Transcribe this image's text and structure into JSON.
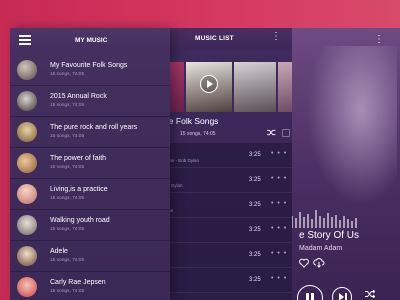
{
  "my_music": {
    "title": "MY MUSIC",
    "playlists": [
      {
        "name": "My Favourite Folk Songs",
        "meta": "15 songs, 74:05"
      },
      {
        "name": "2015 Annual Rock",
        "meta": "15 songs, 74:05"
      },
      {
        "name": "The pure rock and roll years",
        "meta": "15 songs, 74:05"
      },
      {
        "name": "The power of faith",
        "meta": "15 songs, 74:05"
      },
      {
        "name": "Living,is a practice",
        "meta": "15 songs, 74:05"
      },
      {
        "name": "Walking youth road",
        "meta": "15 songs, 74:05"
      },
      {
        "name": "Adele",
        "meta": "15 songs, 74:05"
      },
      {
        "name": "Carly Rae Jepsen",
        "meta": "15 songs, 74:05"
      }
    ]
  },
  "music_list": {
    "title": "MUSIC LIST",
    "album_title": "urite Folk Songs",
    "album_meta": "15 songs, 74:05",
    "tracks": [
      {
        "name": "rst",
        "sub": "b Dylan - Bob Dylan",
        "duration": "3:25",
        "more": "• • •"
      },
      {
        "name": "",
        "sub": "- Bob Dylan",
        "duration": "3:25",
        "more": "• • •"
      },
      {
        "name": "ber",
        "sub": "- Dylan",
        "duration": "3:25",
        "more": "• • •"
      },
      {
        "name": "",
        "sub": "",
        "duration": "3:25",
        "more": "• • •"
      },
      {
        "name": "",
        "sub": "",
        "duration": "3:25",
        "more": "• • •"
      },
      {
        "name": "",
        "sub": "",
        "duration": "3:25",
        "more": "• • •"
      }
    ]
  },
  "player": {
    "song_title": "e Story Of Us",
    "artist": "Madam Adam"
  },
  "icons": {
    "menu": "hamburger-icon",
    "more": "kebab-icon",
    "play": "play-icon",
    "pause": "pause-icon",
    "next": "next-icon",
    "shuffle": "shuffle-icon",
    "heart": "heart-icon",
    "download": "cloud-download-icon"
  },
  "colors": {
    "background": "#d0335c",
    "panel": "#3a2856",
    "accent": "#ffffff"
  }
}
